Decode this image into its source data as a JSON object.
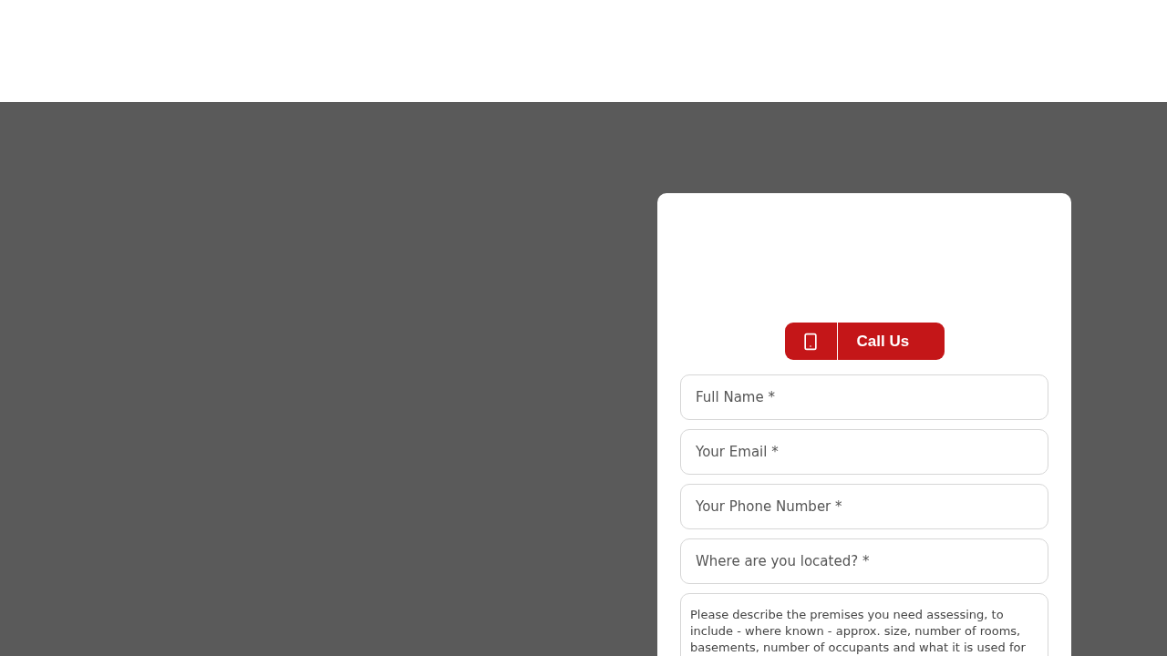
{
  "call_button": {
    "label": "Call Us"
  },
  "form": {
    "fields": [
      {
        "kind": "input",
        "placeholder": "Full Name *"
      },
      {
        "kind": "input",
        "placeholder": "Your Email *"
      },
      {
        "kind": "input",
        "placeholder": "Your Phone Number *"
      },
      {
        "kind": "input",
        "placeholder": "Where are you located? *"
      },
      {
        "kind": "textarea",
        "placeholder": "Please describe the premises you need assessing, to include - where known - approx. size, number of rooms, basements, number of occupants and what it is used for"
      }
    ]
  }
}
